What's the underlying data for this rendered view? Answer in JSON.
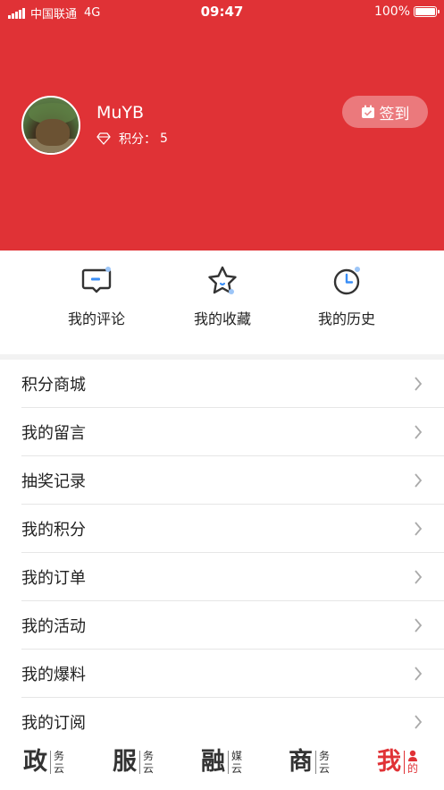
{
  "status_bar": {
    "carrier": "中国联通",
    "network": "4G",
    "time": "09:47",
    "battery": "100%"
  },
  "profile": {
    "username": "MuYB",
    "points_label": "积分：",
    "points_value": "5",
    "checkin_label": "签到"
  },
  "quick_actions": [
    {
      "label": "我的评论",
      "icon": "comment-icon"
    },
    {
      "label": "我的收藏",
      "icon": "star-icon"
    },
    {
      "label": "我的历史",
      "icon": "clock-icon"
    }
  ],
  "menu": [
    {
      "label": "积分商城"
    },
    {
      "label": "我的留言"
    },
    {
      "label": "抽奖记录"
    },
    {
      "label": "我的积分"
    },
    {
      "label": "我的订单"
    },
    {
      "label": "我的活动"
    },
    {
      "label": "我的爆料"
    },
    {
      "label": "我的订阅"
    }
  ],
  "tabbar": [
    {
      "big": "政",
      "small1": "务",
      "small2": "云"
    },
    {
      "big": "服",
      "small1": "务",
      "small2": "云"
    },
    {
      "big": "融",
      "small1": "媒",
      "small2": "云"
    },
    {
      "big": "商",
      "small1": "务",
      "small2": "云"
    },
    {
      "big": "我",
      "small1": "",
      "small2": "的"
    }
  ],
  "colors": {
    "brand_red": "#e03236",
    "icon_accent": "#3a8ef6"
  }
}
